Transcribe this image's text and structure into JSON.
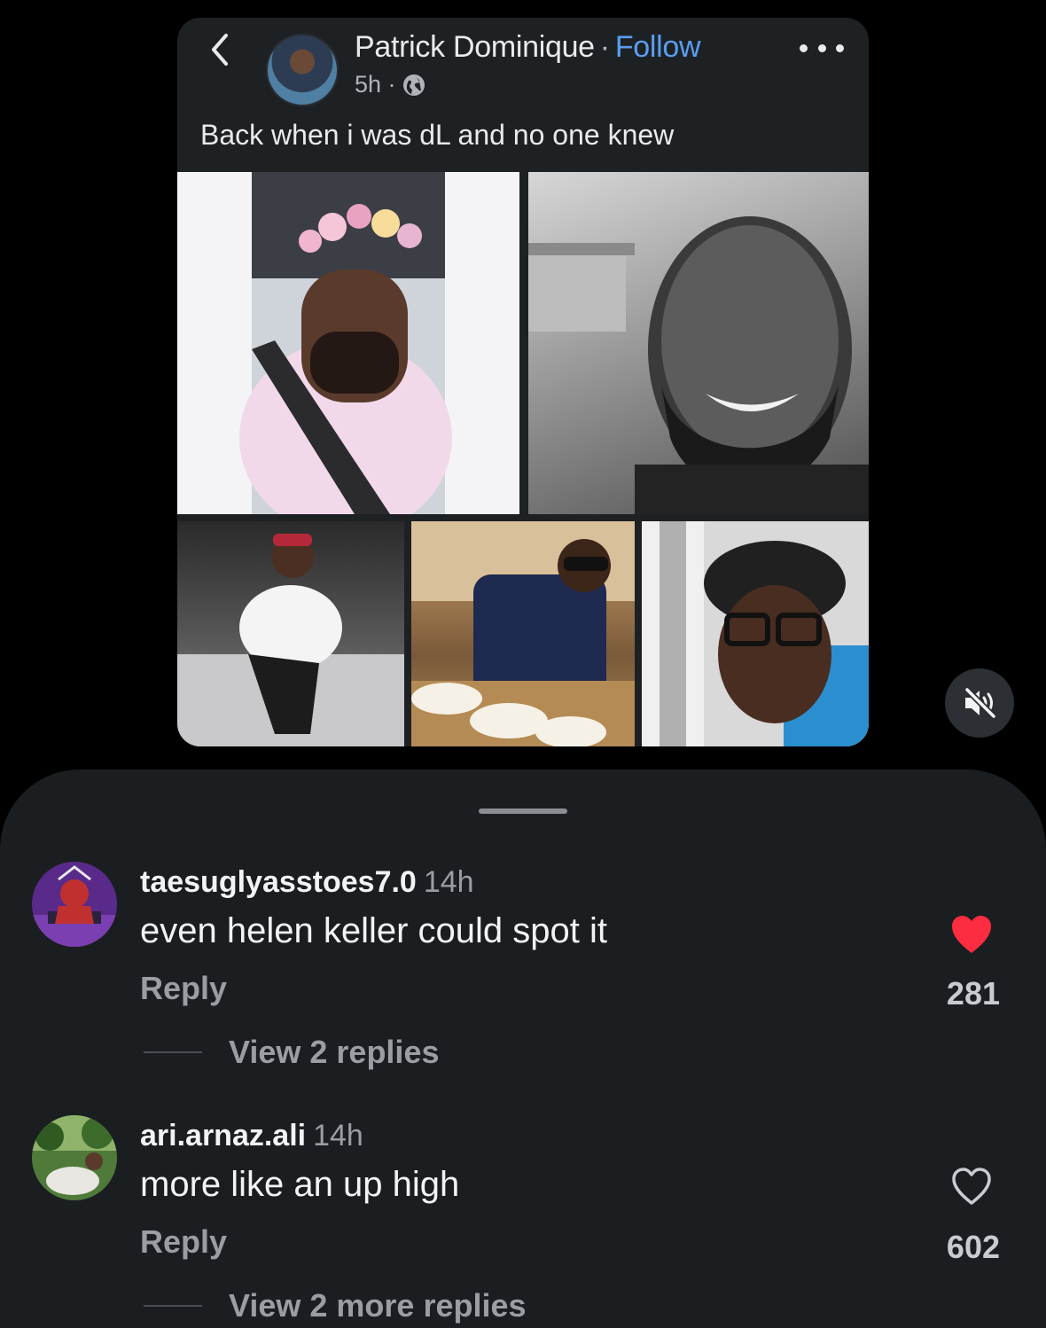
{
  "post": {
    "poster_name": "Patrick Dominique",
    "separator": "·",
    "follow_label": "Follow",
    "time": "5h ·",
    "caption": "Back when i was dL and no one knew"
  },
  "comments": [
    {
      "username": "taesuglyasstoes7.0",
      "time": "14h",
      "text": "even helen keller could spot it",
      "reply_label": "Reply",
      "liked": true,
      "like_count": "281",
      "view_replies": "View 2 replies"
    },
    {
      "username": "ari.arnaz.ali",
      "time": "14h",
      "text": "more like an up high",
      "reply_label": "Reply",
      "liked": false,
      "like_count": "602",
      "view_replies": "View 2 more replies"
    }
  ],
  "colors": {
    "background": "#000000",
    "sheet": "#1b1e21",
    "card": "#1e2124",
    "follow_link": "#5b9df0",
    "like_active": "#fe2c40",
    "muted_text": "#9a9ea3"
  },
  "icons": {
    "back": "chevron-left-icon",
    "globe": "globe-icon",
    "more": "more-horizontal-icon",
    "mute": "speaker-muted-icon",
    "like_filled": "heart-filled-icon",
    "like_outline": "heart-outline-icon"
  }
}
